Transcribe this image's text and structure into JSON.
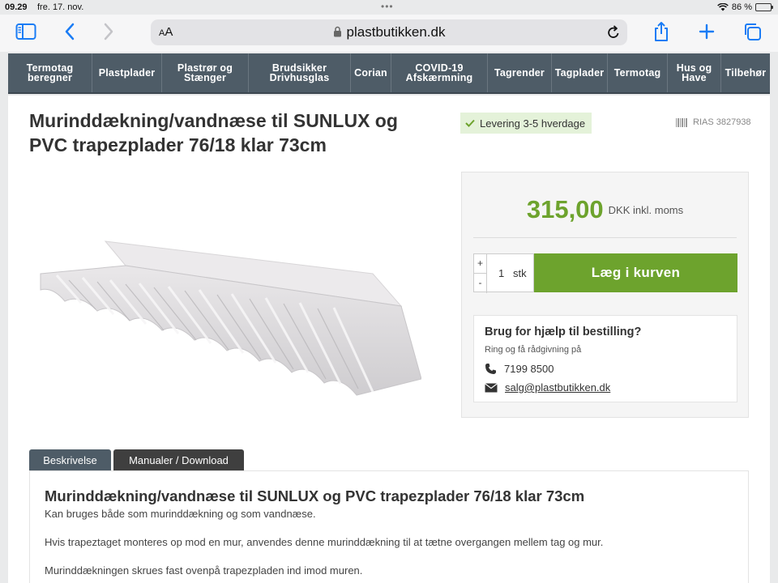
{
  "statusbar": {
    "time": "09.29",
    "date": "fre. 17. nov.",
    "battery": "86 %"
  },
  "browser": {
    "text_size_label": "AA",
    "url": "plastbutikken.dk"
  },
  "nav": {
    "items": [
      {
        "label": "Termotag beregner"
      },
      {
        "label": "Plastplader"
      },
      {
        "label": "Plastrør og Stænger"
      },
      {
        "label": "Brudsikker Drivhusglas"
      },
      {
        "label": "Corian"
      },
      {
        "label": "COVID-19 Afskærmning"
      },
      {
        "label": "Tagrender"
      },
      {
        "label": "Tagplader"
      },
      {
        "label": "Termotag"
      },
      {
        "label": "Hus og Have"
      },
      {
        "label": "Tilbehør"
      }
    ]
  },
  "product": {
    "title": "Murinddækning/vandnæse til SUNLUX og PVC trapezplader 76/18 klar 73cm",
    "delivery": "Levering 3-5 hverdage",
    "sku": "RIAS 3827938",
    "price": "315,00",
    "price_unit": "DKK inkl. moms",
    "quantity": "1",
    "quantity_unit": "stk",
    "add_to_cart": "Læg i kurven"
  },
  "help": {
    "title": "Brug for hjælp til bestilling?",
    "subtitle": "Ring og få rådgivning på",
    "phone": "7199 8500",
    "email": "salg@plastbutikken.dk"
  },
  "tabs": [
    {
      "label": "Beskrivelse",
      "active": true
    },
    {
      "label": "Manualer / Download",
      "active": false
    }
  ],
  "description": {
    "title": "Murinddækning/vandnæse til SUNLUX og PVC trapezplader 76/18 klar 73cm",
    "paragraphs": [
      "Kan bruges både som murinddækning og som vandnæse.",
      "Hvis trapeztaget monteres op mod en mur, anvendes denne murinddækning til at tætne overgangen mellem tag og mur.",
      "Murinddækningen skrues fast ovenpå trapezpladen ind imod muren."
    ]
  },
  "colors": {
    "accent_green": "#6da32d",
    "nav_bg": "#4e5c67",
    "delivery_bg": "#e4f2d9"
  }
}
